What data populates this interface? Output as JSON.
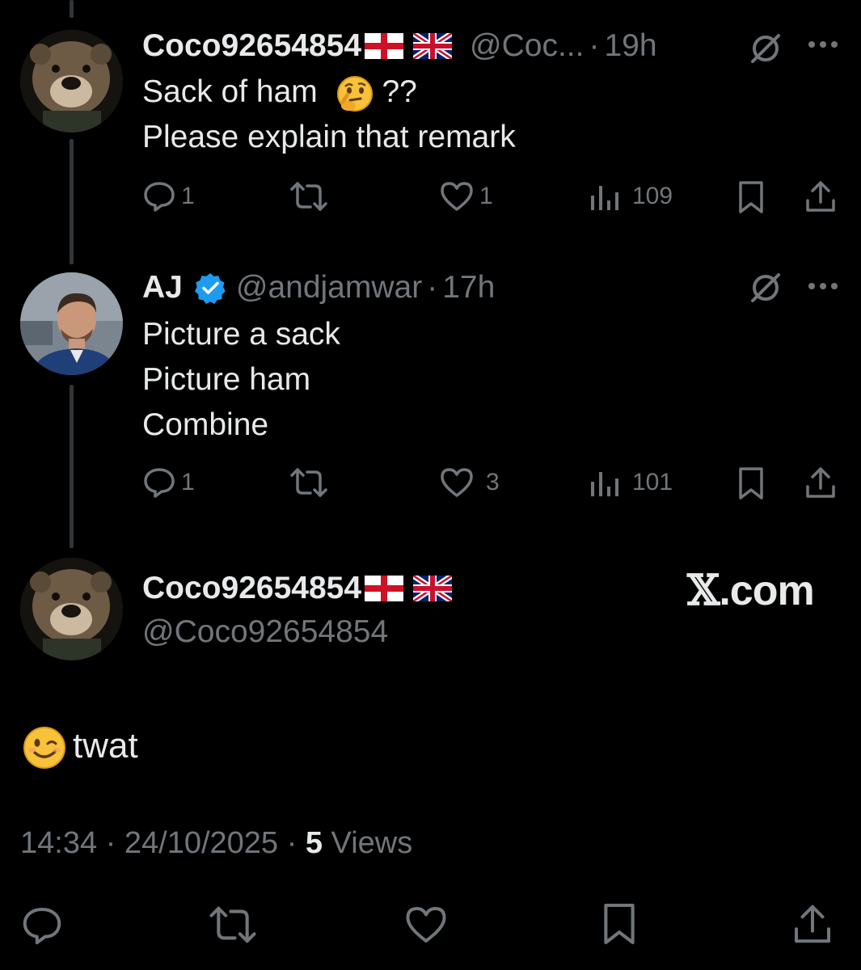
{
  "tweets": [
    {
      "name": "Coco92654854",
      "flags": [
        "england-flag",
        "uk-flag"
      ],
      "handle": "@Coc...",
      "time": "19h",
      "lines": [
        "Sack of ham",
        "??",
        "Please explain that remark"
      ],
      "emoji": "thinking-face",
      "replies": "1",
      "retweets": "",
      "likes": "1",
      "views": "109"
    },
    {
      "name": "AJ",
      "verified": true,
      "handle": "@andjamwar",
      "time": "17h",
      "lines": [
        "Picture a sack",
        "Picture ham",
        "Combine"
      ],
      "replies": "1",
      "retweets": "",
      "likes": "3",
      "views": "101"
    }
  ],
  "focus": {
    "name": "Coco92654854",
    "flags": [
      "england-flag",
      "uk-flag"
    ],
    "handle": "@Coco92654854",
    "emoji": "winking-face",
    "text": "twat",
    "time": "14:34",
    "date": "24/10/2025",
    "views_count": "5",
    "views_label": "Views"
  },
  "watermark": {
    "mark": "𝕏",
    "text": ".com"
  },
  "colors": {
    "background": "#000000",
    "text": "#e7e9ea",
    "muted": "#71767b",
    "thread_line": "#333639",
    "verified": "#1d9bf0"
  },
  "icons": [
    "grok-icon",
    "more-icon",
    "reply-icon",
    "retweet-icon",
    "like-icon",
    "views-icon",
    "bookmark-icon",
    "share-icon"
  ]
}
